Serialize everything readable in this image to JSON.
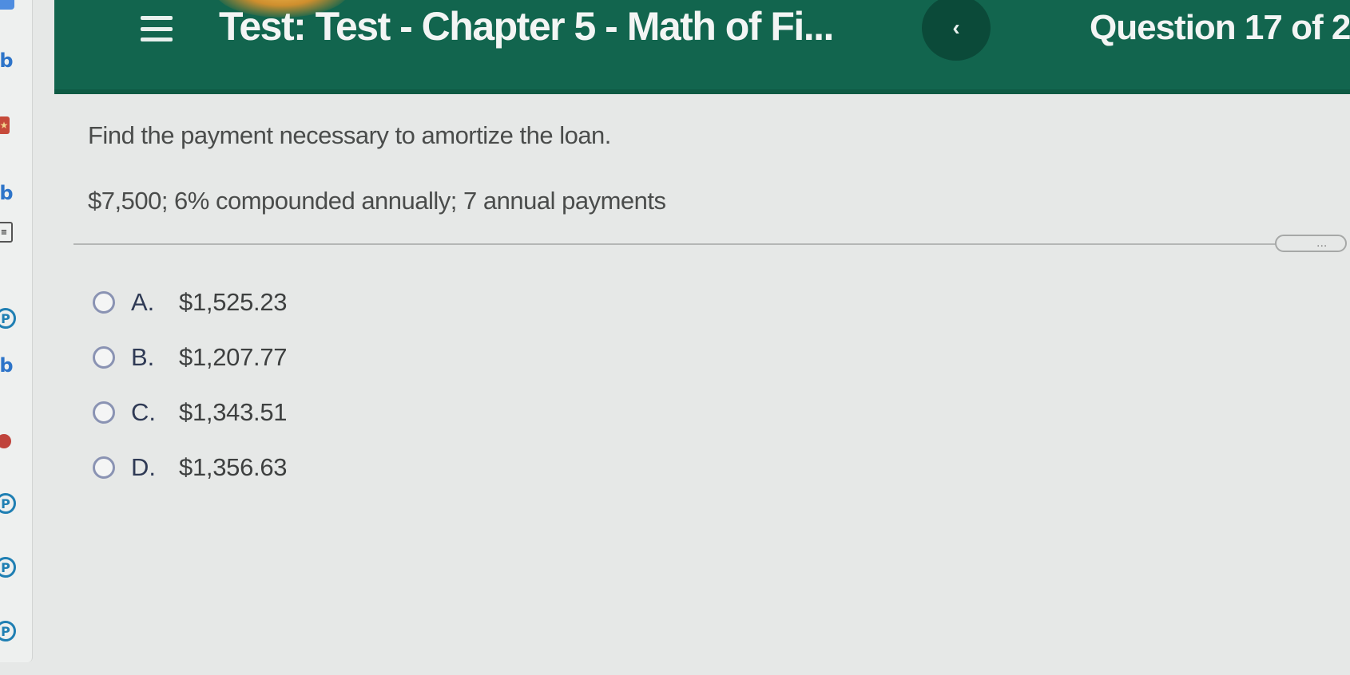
{
  "header": {
    "title": "Test: Test - Chapter 5 - Math of Fi...",
    "back_label": "‹",
    "question_counter": "Question 17 of 2"
  },
  "question": {
    "prompt": "Find the payment necessary to amortize the loan.",
    "details": "$7,500; 6% compounded annually; 7 annual payments",
    "more_label": "..."
  },
  "choices": [
    {
      "letter": "A.",
      "value": "$1,525.23"
    },
    {
      "letter": "B.",
      "value": "$1,207.77"
    },
    {
      "letter": "C.",
      "value": "$1,343.51"
    },
    {
      "letter": "D.",
      "value": "$1,356.63"
    }
  ],
  "colors": {
    "header_bg": "#12654e",
    "radio_border": "#8a93b3"
  },
  "icons": {
    "menu": "hamburger-menu-icon",
    "back": "chevron-left-icon"
  }
}
